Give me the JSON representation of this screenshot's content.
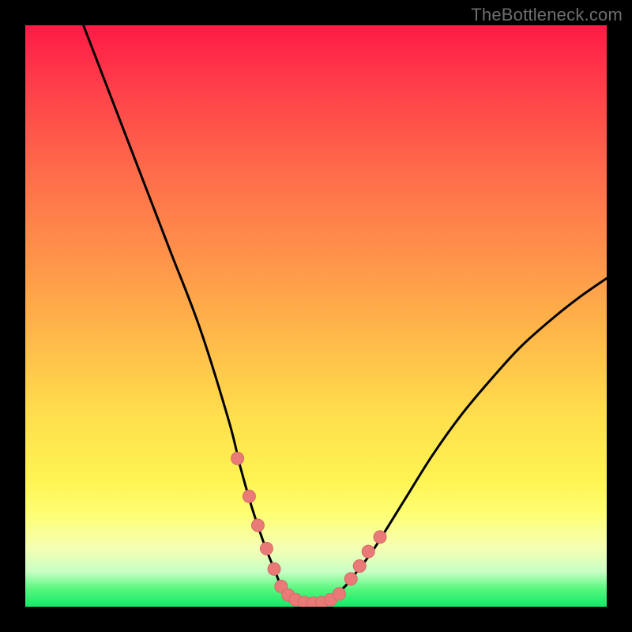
{
  "watermark": "TheBottleneck.com",
  "colors": {
    "frame": "#000000",
    "curve": "#000000",
    "dotFill": "#e97a78",
    "dotStroke": "#d46a68",
    "gradientStops": [
      {
        "pos": 0,
        "color": "#ff1a46"
      },
      {
        "pos": 10,
        "color": "#ff3d4a"
      },
      {
        "pos": 25,
        "color": "#ff6b4b"
      },
      {
        "pos": 40,
        "color": "#ff934a"
      },
      {
        "pos": 53,
        "color": "#ffb749"
      },
      {
        "pos": 67,
        "color": "#ffde4d"
      },
      {
        "pos": 78,
        "color": "#fff352"
      },
      {
        "pos": 84,
        "color": "#feff73"
      },
      {
        "pos": 90,
        "color": "#f4ffb4"
      },
      {
        "pos": 94,
        "color": "#c9ffc4"
      },
      {
        "pos": 97,
        "color": "#55f77d"
      },
      {
        "pos": 100,
        "color": "#14e868"
      }
    ]
  },
  "chart_data": {
    "type": "line",
    "title": "",
    "xlabel": "",
    "ylabel": "",
    "xlim": [
      0,
      100
    ],
    "ylim": [
      0,
      100
    ],
    "grid": false,
    "series": [
      {
        "name": "bottleneck-curve",
        "x": [
          10,
          15,
          20,
          25,
          30,
          35,
          37,
          39,
          41,
          43,
          44,
          45,
          46,
          47,
          48,
          50,
          52,
          55,
          57,
          60,
          65,
          70,
          75,
          80,
          85,
          90,
          95,
          100
        ],
        "y": [
          100,
          87,
          74,
          61,
          48,
          32,
          24,
          17,
          11,
          6,
          3.5,
          2,
          1.2,
          0.8,
          0.6,
          0.6,
          1.0,
          3.5,
          6,
          10,
          18,
          26,
          33,
          39,
          44.5,
          49,
          53,
          56.5
        ]
      }
    ],
    "points": {
      "name": "marked-dots",
      "x": [
        36.5,
        38.5,
        40.0,
        41.5,
        42.8,
        44.0,
        45.2,
        46.5,
        48.0,
        49.5,
        51.0,
        52.5,
        54.0,
        56.0,
        57.5,
        59.0,
        61.0
      ],
      "y": [
        25.5,
        19.0,
        14.0,
        10.0,
        6.5,
        3.5,
        2.0,
        1.2,
        0.7,
        0.6,
        0.7,
        1.2,
        2.2,
        4.8,
        7.0,
        9.5,
        12.0
      ]
    }
  }
}
